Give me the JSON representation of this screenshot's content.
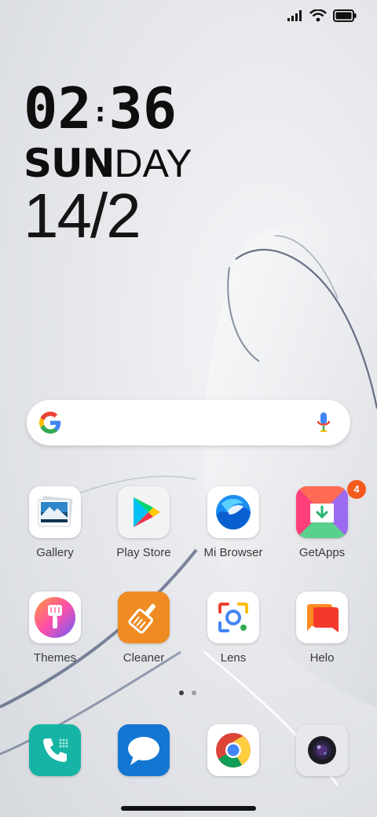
{
  "status_bar": {
    "signal_icon": "cellular-signal-icon",
    "wifi_icon": "wifi-icon",
    "battery_icon": "battery-icon"
  },
  "clock_widget": {
    "time_hours": "02",
    "time_separator": ":",
    "time_minutes": "36",
    "day_bold": "SUN",
    "day_thin": "DAY",
    "date": "14/2"
  },
  "search_bar": {
    "logo_icon": "google-g-icon",
    "mic_icon": "microphone-icon"
  },
  "apps_row1": [
    {
      "label": "Gallery",
      "icon": "gallery-icon"
    },
    {
      "label": "Play Store",
      "icon": "play-store-icon"
    },
    {
      "label": "Mi Browser",
      "icon": "mi-browser-icon"
    },
    {
      "label": "GetApps",
      "icon": "getapps-icon",
      "badge": "4"
    }
  ],
  "apps_row2": [
    {
      "label": "Themes",
      "icon": "themes-icon"
    },
    {
      "label": "Cleaner",
      "icon": "cleaner-icon"
    },
    {
      "label": "Lens",
      "icon": "lens-icon"
    },
    {
      "label": "Helo",
      "icon": "helo-icon"
    }
  ],
  "dock": [
    {
      "icon": "phone-icon"
    },
    {
      "icon": "messages-icon"
    },
    {
      "icon": "chrome-icon"
    },
    {
      "icon": "camera-icon"
    }
  ],
  "page_indicator": {
    "pages": 2,
    "active": 1
  },
  "colors": {
    "badge": "#f45a1d",
    "text_dark": "#0e0e0e",
    "label": "#3a3a3a"
  }
}
